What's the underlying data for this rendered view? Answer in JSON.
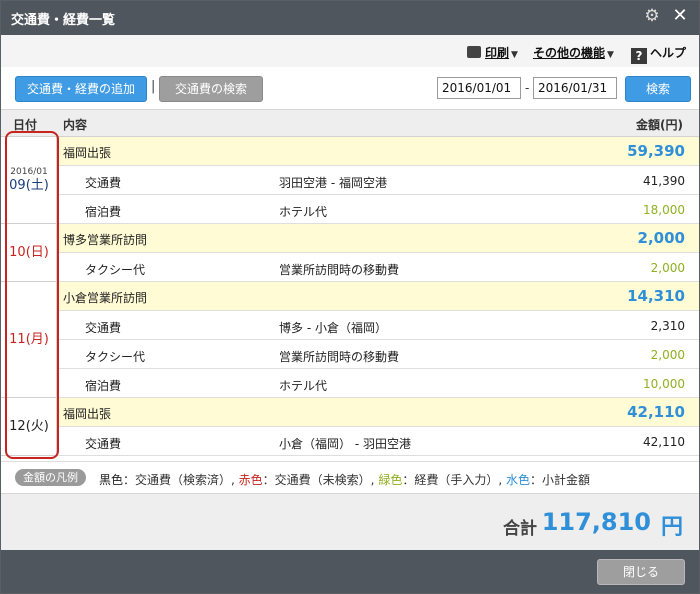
{
  "window": {
    "title": "交通費・経費一覧"
  },
  "menu": {
    "print": "印刷",
    "other": "その他の機能",
    "help": "ヘルプ"
  },
  "toolbar": {
    "add_label": "交通費・経費の追加",
    "search_transport_label": "交通費の検索",
    "separator": "|",
    "date_from": "2016/01/01",
    "date_dash": "-",
    "date_to": "2016/01/31",
    "search_label": "検索"
  },
  "table": {
    "headers": {
      "date": "日付",
      "content": "内容",
      "amount": "金額(円)"
    }
  },
  "days": [
    {
      "year": "2016/01",
      "day": "09(土)",
      "day_color": "#1a3e7a",
      "groups": [
        {
          "name": "福岡出張",
          "amount": "59,390",
          "items": [
            {
              "category": "交通費",
              "desc": "羽田空港 - 福岡空港",
              "amount": "41,390",
              "color": "#222222"
            },
            {
              "category": "宿泊費",
              "desc": "ホテル代",
              "amount": "18,000",
              "color": "#8fb020"
            }
          ]
        }
      ]
    },
    {
      "year": "",
      "day": "10(日)",
      "day_color": "#c8231f",
      "groups": [
        {
          "name": "博多営業所訪問",
          "amount": "2,000",
          "items": [
            {
              "category": "タクシー代",
              "desc": "営業所訪問時の移動費",
              "amount": "2,000",
              "color": "#8fb020"
            }
          ]
        }
      ]
    },
    {
      "year": "",
      "day": "11(月)",
      "day_color": "#c8231f",
      "groups": [
        {
          "name": "小倉営業所訪問",
          "amount": "14,310",
          "items": [
            {
              "category": "交通費",
              "desc": "博多 - 小倉（福岡）",
              "amount": "2,310",
              "color": "#222222"
            },
            {
              "category": "タクシー代",
              "desc": "営業所訪問時の移動費",
              "amount": "2,000",
              "color": "#8fb020"
            },
            {
              "category": "宿泊費",
              "desc": "ホテル代",
              "amount": "10,000",
              "color": "#8fb020"
            }
          ]
        }
      ]
    },
    {
      "year": "",
      "day": "12(火)",
      "day_color": "#222222",
      "groups": [
        {
          "name": "福岡出張",
          "amount": "42,110",
          "items": [
            {
              "category": "交通費",
              "desc": "小倉（福岡） - 羽田空港",
              "amount": "42,110",
              "color": "#222222"
            }
          ]
        }
      ]
    }
  ],
  "legend": {
    "badge": "金額の凡例",
    "parts": [
      {
        "text": "黒色",
        "color": "#222222"
      },
      {
        "text": "：交通費（検索済）, ",
        "color": "#333333"
      },
      {
        "text": "赤色",
        "color": "#c8231f"
      },
      {
        "text": "：交通費（未検索）, ",
        "color": "#333333"
      },
      {
        "text": "緑色",
        "color": "#8fb020"
      },
      {
        "text": "：経費（手入力）, ",
        "color": "#333333"
      },
      {
        "text": "水色",
        "color": "#2f8fd8"
      },
      {
        "text": "：小計金額",
        "color": "#333333"
      }
    ]
  },
  "total": {
    "label": "合計",
    "value": "117,810",
    "unit": "円"
  },
  "footer": {
    "close_label": "閉じる"
  },
  "icons": {
    "settings": "gear-icon",
    "close": "close-icon",
    "print": "printer-icon",
    "help": "help-icon"
  }
}
